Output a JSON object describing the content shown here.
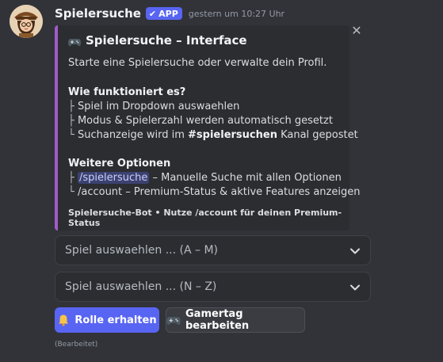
{
  "message": {
    "author": "Spielersuche",
    "app_badge": "APP",
    "timestamp": "gestern um 10:27 Uhr",
    "edited": "(Bearbeitet)"
  },
  "embed": {
    "title": "Spielersuche – Interface",
    "description": "Starte eine Spielersuche oder verwalte dein Profil.",
    "how_heading": "Wie funktioniert es?",
    "how_steps": [
      {
        "prefix": "├",
        "text": "Spiel im Dropdown auswaehlen"
      },
      {
        "prefix": "├",
        "text": "Modus & Spielerzahl werden automatisch gesetzt"
      },
      {
        "prefix": "└",
        "text_before": "Suchanzeige wird im ",
        "channel": "#spielersuchen",
        "text_after": " Kanal gepostet"
      }
    ],
    "more_heading": "Weitere Optionen",
    "more_items": [
      {
        "prefix": "├",
        "command": "/spielersuche",
        "text": " – Manuelle Suche mit allen Optionen"
      },
      {
        "prefix": "└",
        "command": "/account",
        "text": " – Premium-Status & aktive Features anzeigen"
      }
    ],
    "footer": "Spielersuche-Bot • Nutze /account für deinen Premium-Status",
    "accent_color": "#a05cc7"
  },
  "components": {
    "select_1_placeholder": "Spiel auswaehlen ... (A – M)",
    "select_2_placeholder": "Spiel auswaehlen ... (N – Z)",
    "button_primary_label": "Rolle erhalten",
    "button_secondary_label": "Gamertag bearbeiten",
    "button_primary_icon": "bell-icon",
    "button_secondary_icon": "gamepad-icon"
  },
  "colors": {
    "blurple": "#5865f2",
    "background": "#323339",
    "embed_background": "#2b2d31"
  }
}
